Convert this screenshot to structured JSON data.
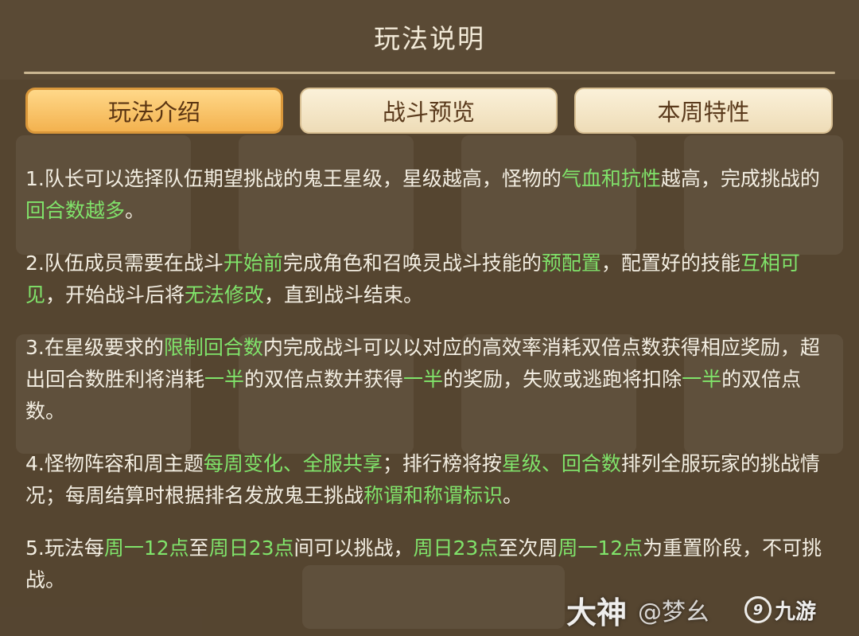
{
  "dialog": {
    "title": "玩法说明"
  },
  "tabs": [
    {
      "label": "玩法介绍",
      "active": true
    },
    {
      "label": "战斗预览",
      "active": false
    },
    {
      "label": "本周特性",
      "active": false
    }
  ],
  "paragraphs": [
    [
      {
        "t": "1.队长可以选择队伍期望挑战的鬼王星级，星级越高，怪物的",
        "hl": false
      },
      {
        "t": "气血和抗性",
        "hl": true
      },
      {
        "t": "越高，完成挑战的",
        "hl": false
      },
      {
        "t": "回合数越多",
        "hl": true
      },
      {
        "t": "。",
        "hl": false
      }
    ],
    [
      {
        "t": "2.队伍成员需要在战斗",
        "hl": false
      },
      {
        "t": "开始前",
        "hl": true
      },
      {
        "t": "完成角色和召唤灵战斗技能的",
        "hl": false
      },
      {
        "t": "预配置",
        "hl": true
      },
      {
        "t": "，配置好的技能",
        "hl": false
      },
      {
        "t": "互相可见",
        "hl": true
      },
      {
        "t": "，开始战斗后将",
        "hl": false
      },
      {
        "t": "无法修改",
        "hl": true
      },
      {
        "t": "，直到战斗结束。",
        "hl": false
      }
    ],
    [
      {
        "t": "3.在星级要求的",
        "hl": false
      },
      {
        "t": "限制回合数",
        "hl": true
      },
      {
        "t": "内完成战斗可以以对应的高效率消耗双倍点数获得相应奖励，超出回合数胜利将消耗",
        "hl": false
      },
      {
        "t": "一半",
        "hl": true
      },
      {
        "t": "的双倍点数并获得",
        "hl": false
      },
      {
        "t": "一半",
        "hl": true
      },
      {
        "t": "的奖励，失败或逃跑将扣除",
        "hl": false
      },
      {
        "t": "一半",
        "hl": true
      },
      {
        "t": "的双倍点数。",
        "hl": false
      }
    ],
    [
      {
        "t": "4.怪物阵容和周主题",
        "hl": false
      },
      {
        "t": "每周变化、全服共享",
        "hl": true
      },
      {
        "t": "；排行榜将按",
        "hl": false
      },
      {
        "t": "星级、回合数",
        "hl": true
      },
      {
        "t": "排列全服玩家的挑战情况；每周结算时根据排名发放鬼王挑战",
        "hl": false
      },
      {
        "t": "称谓和称谓标识",
        "hl": true
      },
      {
        "t": "。",
        "hl": false
      }
    ],
    [
      {
        "t": "5.玩法每",
        "hl": false
      },
      {
        "t": "周一12点",
        "hl": true
      },
      {
        "t": "至",
        "hl": false
      },
      {
        "t": "周日23点",
        "hl": true
      },
      {
        "t": "间可以挑战，",
        "hl": false
      },
      {
        "t": "周日23点",
        "hl": true
      },
      {
        "t": "至次周",
        "hl": false
      },
      {
        "t": "周一12点",
        "hl": true
      },
      {
        "t": "为重置阶段，不可挑战。",
        "hl": false
      }
    ]
  ],
  "watermark": {
    "brand": "大神",
    "handle": "@梦幺",
    "logo": "九游"
  },
  "colors": {
    "highlight": "#80e36a",
    "text": "#f3eee2",
    "tab_active": "#f3b24f",
    "tab_inactive": "#f6e8c8"
  }
}
